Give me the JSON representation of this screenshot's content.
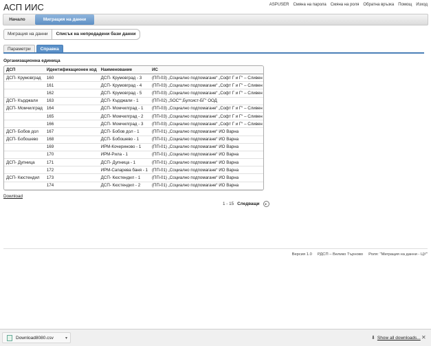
{
  "app": {
    "title": "АСП ИИС"
  },
  "top_links": [
    "ASPUSER",
    "Смяна на парола",
    "Смяна на роля",
    "Обратна връзка",
    "Помощ",
    "Изход"
  ],
  "nav": {
    "home": "Начало",
    "migration": "Миграция на данни"
  },
  "breadcrumb": {
    "parent": "Миграция на данни",
    "current": "Списък на непредадени бази данни"
  },
  "tabs": {
    "params": "Параметри",
    "report": "Справка"
  },
  "section_title": "Организационна единица",
  "table": {
    "headers": [
      "ДСП",
      "Идентификационен код",
      "Наименование",
      "ИС"
    ],
    "rows": [
      [
        "ДСП- Крумовград",
        "160",
        "ДСП- Крумовград - 3",
        "(ПП-03) „Социално подпомагане“ „Софт Г и Г“ – Сливен"
      ],
      [
        "",
        "161",
        "ДСП- Крумовград - 4",
        "(ПП-03) „Социално подпомагане“ „Софт Г и Г“ – Сливен"
      ],
      [
        "",
        "162",
        "ДСП- Крумовград - 5",
        "(ПП-03) „Социално подпомагане“ „Софт Г и Г“ – Сливен"
      ],
      [
        "ДСП- Кърджали",
        "163",
        "ДСП- Кърджали - 1",
        "(ПП-02) „SOC““,Булсист-БГ“ ООД"
      ],
      [
        "ДСП- Момчилград",
        "164",
        "ДСП- Момчилград - 1",
        "(ПП-03) „Социално подпомагане“ „Софт Г и Г“ – Сливен"
      ],
      [
        "",
        "165",
        "ДСП- Момчилград - 2",
        "(ПП-03) „Социално подпомагане“ „Софт Г и Г“ – Сливен"
      ],
      [
        "",
        "166",
        "ДСП- Момчилград - 3",
        "(ПП-03) „Социално подпомагане“ „Софт Г и Г“ – Сливен"
      ],
      [
        "ДСП- Бобов дол",
        "167",
        "ДСП- Бобов дол - 1",
        "(ПП-01) „Социално подпомагане“ ИО Варна"
      ],
      [
        "ДСП- Бобошево",
        "168",
        "ДСП- Бобошево - 1",
        "(ПП-01) „Социално подпомагане“ ИО Варна"
      ],
      [
        "",
        "169",
        "ИРМ-Кочериново - 1",
        "(ПП-01) „Социално подпомагане“ ИО Варна"
      ],
      [
        "",
        "170",
        "ИРМ-Рила - 1",
        "(ПП-01) „Социално подпомагане“ ИО Варна"
      ],
      [
        "ДСП- Дупница",
        "171",
        "ДСП- Дупница - 1",
        "(ПП-01) „Социално подпомагане“ ИО Варна"
      ],
      [
        "",
        "172",
        "ИРМ-Сапарева баня - 1",
        "(ПП-01) „Социално подпомагане“ ИО Варна"
      ],
      [
        "ДСП- Кюстендил",
        "173",
        "ДСП- Кюстендил - 1",
        "(ПП-01) „Социално подпомагане“ ИО Варна"
      ],
      [
        "",
        "174",
        "ДСП- Кюстендил - 2",
        "(ПП-01) „Социално подпомагане“ ИО Варна"
      ]
    ]
  },
  "download_link": "Download",
  "pager": {
    "range": "1 - 15",
    "next": "Следващи"
  },
  "footer": {
    "version": "Версия 1.0",
    "org": "РДСП – Велико Търново",
    "role": "Роля: \"Миграция на данни - ЦУ\""
  },
  "downloads_bar": {
    "file": "Download8080.csv",
    "show_all": "Show all downloads..."
  },
  "colors": {
    "accent": "#5a90c8",
    "tab_line": "#4a7fb7"
  }
}
